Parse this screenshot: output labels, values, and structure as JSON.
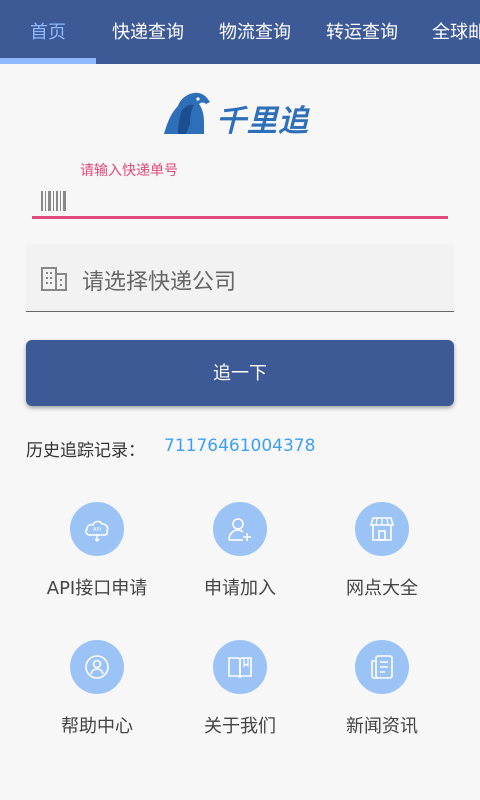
{
  "tabs": [
    {
      "label": "首页",
      "active": true
    },
    {
      "label": "快递查询"
    },
    {
      "label": "物流查询"
    },
    {
      "label": "转运查询"
    },
    {
      "label": "全球邮"
    }
  ],
  "logo": {
    "text": "千里追"
  },
  "tracking": {
    "label": "请输入快递单号",
    "value": ""
  },
  "company": {
    "placeholder": "请选择快递公司"
  },
  "button": {
    "label": "追一下"
  },
  "history": {
    "label": "历史追踪记录：",
    "value": "71176461004378"
  },
  "grid": [
    {
      "label": "API接口申请",
      "icon": "cloud-api-icon"
    },
    {
      "label": "申请加入",
      "icon": "add-user-icon"
    },
    {
      "label": "网点大全",
      "icon": "store-icon"
    },
    {
      "label": "帮助中心",
      "icon": "help-person-icon"
    },
    {
      "label": "关于我们",
      "icon": "book-icon"
    },
    {
      "label": "新闻资讯",
      "icon": "news-icon"
    }
  ],
  "colors": {
    "primary": "#3d5a96",
    "accent": "#e04a78",
    "link": "#3ea0f0",
    "icon_bg": "#9cc3f6"
  }
}
